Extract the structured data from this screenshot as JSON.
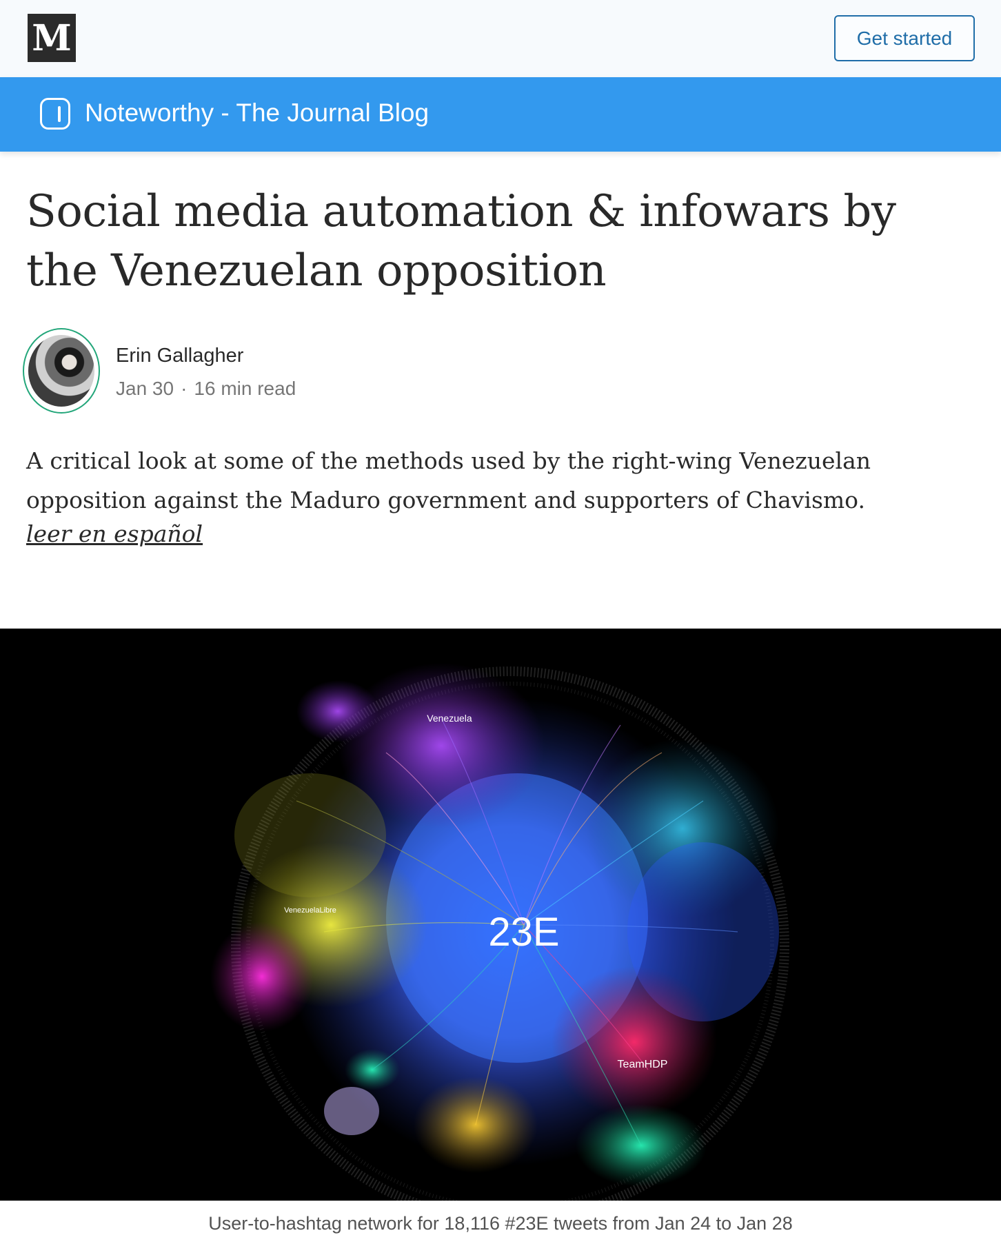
{
  "header": {
    "logo_text": "M",
    "get_started_label": "Get started"
  },
  "publication": {
    "name": "Noteworthy - The Journal Blog",
    "icon": "noteworthy-logo-icon",
    "color": "#3399ee"
  },
  "article": {
    "title": "Social media automation & infowars by the Venezuelan opposition",
    "author": "Erin Gallagher",
    "date": "Jan 30",
    "separator": "·",
    "read_time": "16 min read",
    "intro": "A critical look at some of the methods used by the right-wing Venezuelan opposition against the Maduro government and supporters of Chavismo.",
    "spanish_link": "leer en español"
  },
  "figure": {
    "center_label": "23E",
    "labels": {
      "venezuela": "Venezuela",
      "venezuela_libre": "VenezuelaLibre",
      "team_hdp": "TeamHDP"
    },
    "caption": "User-to-hashtag network for 18,116 #23E tweets from Jan 24 to Jan 28"
  },
  "colors": {
    "accent_border": "#1f6da8",
    "avatar_ring": "#23a67a"
  }
}
